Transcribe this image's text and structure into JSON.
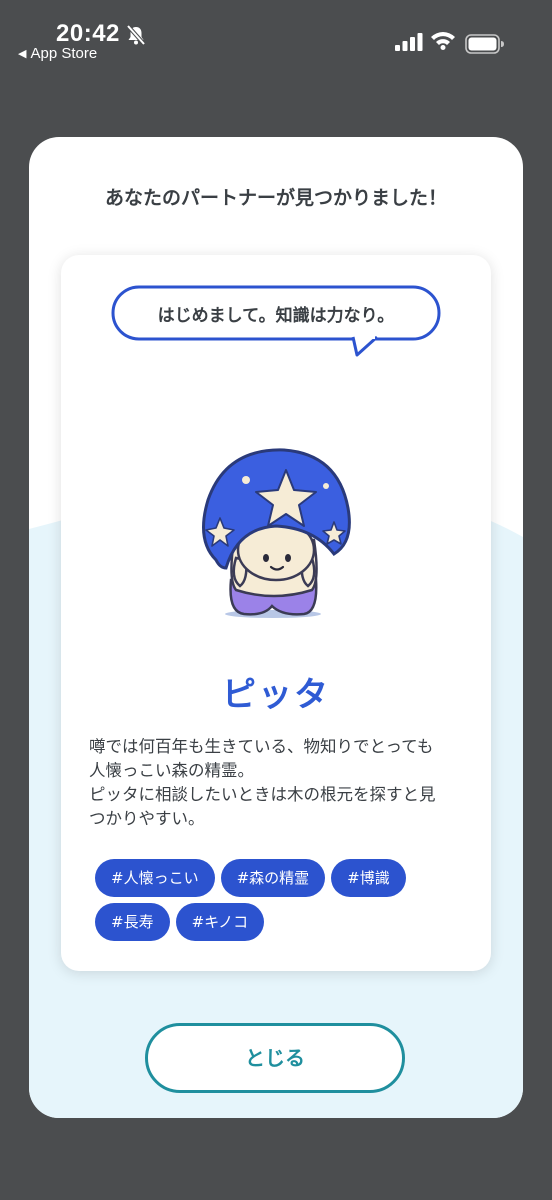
{
  "status_bar": {
    "time": "20:42",
    "back_label": "App Store",
    "back_glyph": "◀",
    "icons": [
      "bell-slash-icon",
      "cellular-signal-icon",
      "wifi-icon",
      "battery-icon"
    ]
  },
  "modal": {
    "title": "あなたのパートナーが見つかりました！",
    "close_button_label": "とじる"
  },
  "profile": {
    "speech_bubble": "はじめまして。知識は力なり。",
    "name": "ピッタ",
    "description_lines": [
      "噂では何百年も生きている、物知りでとっても",
      "人懐っこい森の精霊。",
      "ピッタに相談したいときは木の根元を探すと見",
      "つかりやすい。"
    ],
    "tags": [
      "#人懐っこい",
      "#森の精霊",
      "#博識",
      "#長寿",
      "#キノコ"
    ]
  },
  "colors": {
    "status_background": "#4b4d4f",
    "accent_blue": "#2c53cf",
    "name_blue": "#2f5bd4",
    "close_teal": "#1f8f9e",
    "light_sky": "#e6f5fb"
  }
}
